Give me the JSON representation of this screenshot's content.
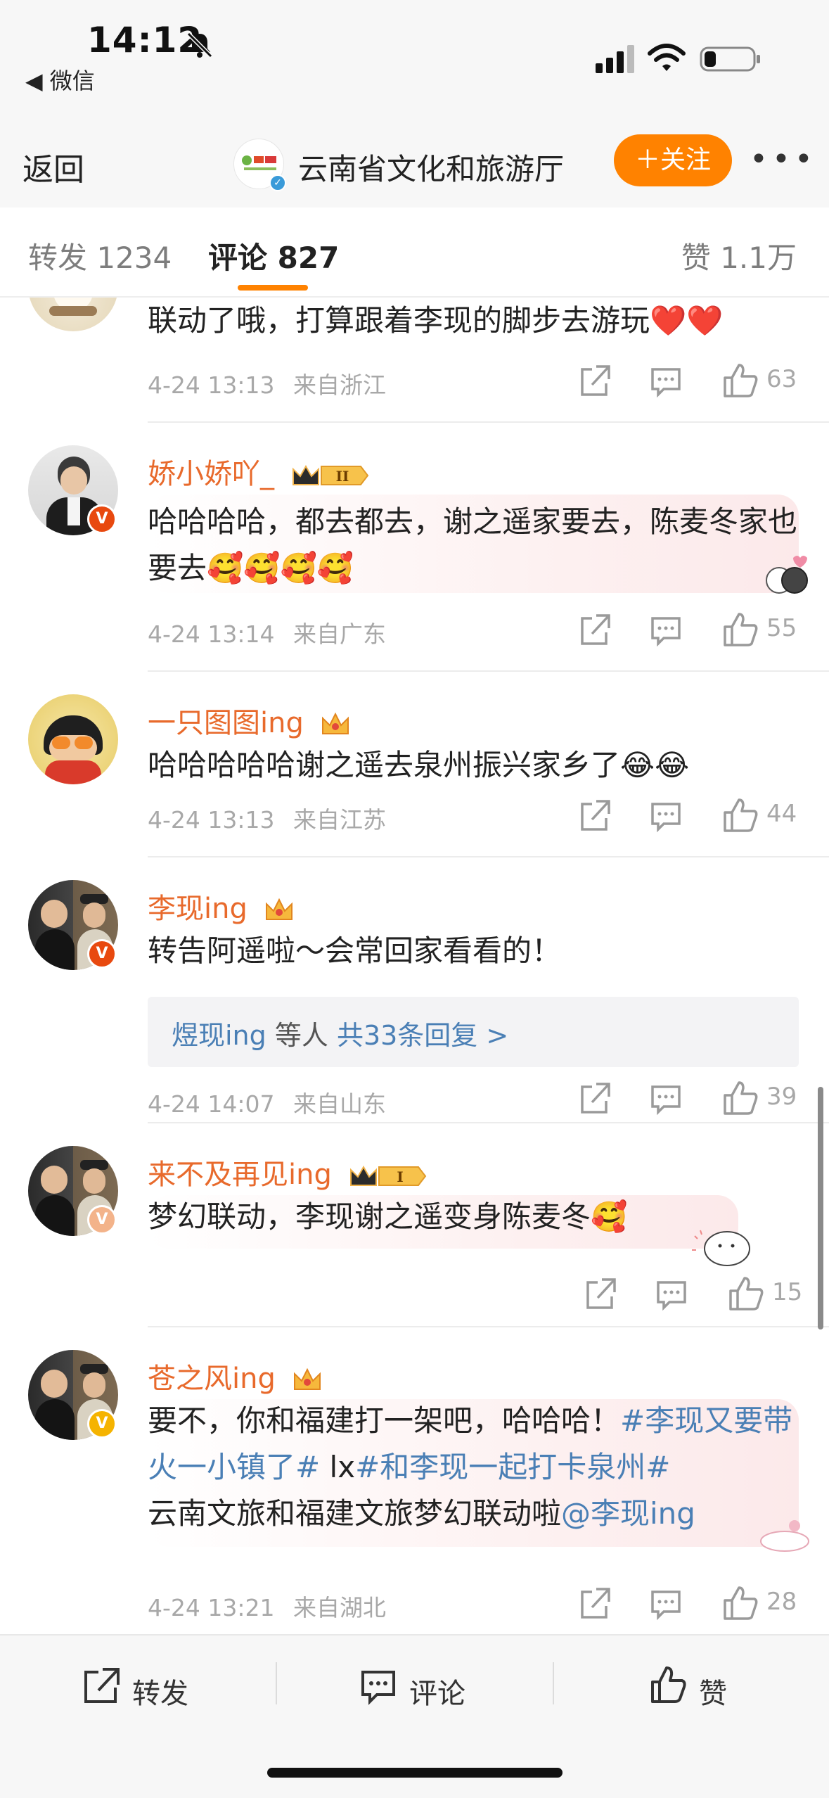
{
  "status_bar": {
    "time": "14:12",
    "back_app": "◀ 微信"
  },
  "nav": {
    "back_label": "返回",
    "account_name": "云南省文化和旅游厅",
    "follow_label": "＋关注",
    "more_label": "•••"
  },
  "tabs": {
    "forward": "转发 1234",
    "comment": "评论 827",
    "like": "赞 1.1万"
  },
  "comments": [
    {
      "text": "联动了哦，打算跟着李现的脚步去游玩❤️❤️",
      "time": "4-24 13:13",
      "location": "来自浙江",
      "likes": "63"
    },
    {
      "username": "娇小娇吖_",
      "level_badge": "II",
      "text": "哈哈哈哈，都去都去，谢之遥家要去，陈麦冬家也要去🥰🥰🥰🥰",
      "time": "4-24 13:14",
      "location": "来自广东",
      "likes": "55"
    },
    {
      "username": "一只图图ing",
      "text": "哈哈哈哈哈谢之遥去泉州振兴家乡了😂😂",
      "time": "4-24 13:13",
      "location": "来自江苏",
      "likes": "44"
    },
    {
      "username": "李现ing",
      "text": "转告阿遥啦～会常回家看看的！",
      "replies_user": "煜现ing",
      "replies_mid": " 等人 ",
      "replies_count": "共33条回复 >",
      "time": "4-24 14:07",
      "location": "来自山东",
      "likes": "39"
    },
    {
      "username": "来不及再见ing",
      "level_badge": "I",
      "text": "梦幻联动，李现谢之遥变身陈麦冬🥰",
      "likes": "15"
    },
    {
      "username": "苍之风ing",
      "text_part1": "要不，你和福建打一架吧，哈哈哈！",
      "topic1": "#李现又要带火一小镇了#",
      "text_part2": " lx",
      "topic2": "#和李现一起打卡泉州#",
      "text_part3": "云南文旅和福建文旅梦幻联动啦",
      "mention": "@李现ing",
      "time": "4-24 13:21",
      "location": "来自湖北",
      "likes": "28"
    }
  ],
  "bottom_bar": {
    "forward": "转发",
    "comment": "评论",
    "like": "赞"
  },
  "colors": {
    "accent_orange": "#ff8200",
    "username_orange": "#e86a2c",
    "link_blue": "#4a7fb5",
    "meta_gray": "#a8a8a8"
  },
  "icons": [
    "bell-slash-icon",
    "signal-icon",
    "wifi-icon",
    "battery-icon",
    "share-icon",
    "comment-icon",
    "like-icon",
    "crown-icon",
    "verified-icon"
  ]
}
